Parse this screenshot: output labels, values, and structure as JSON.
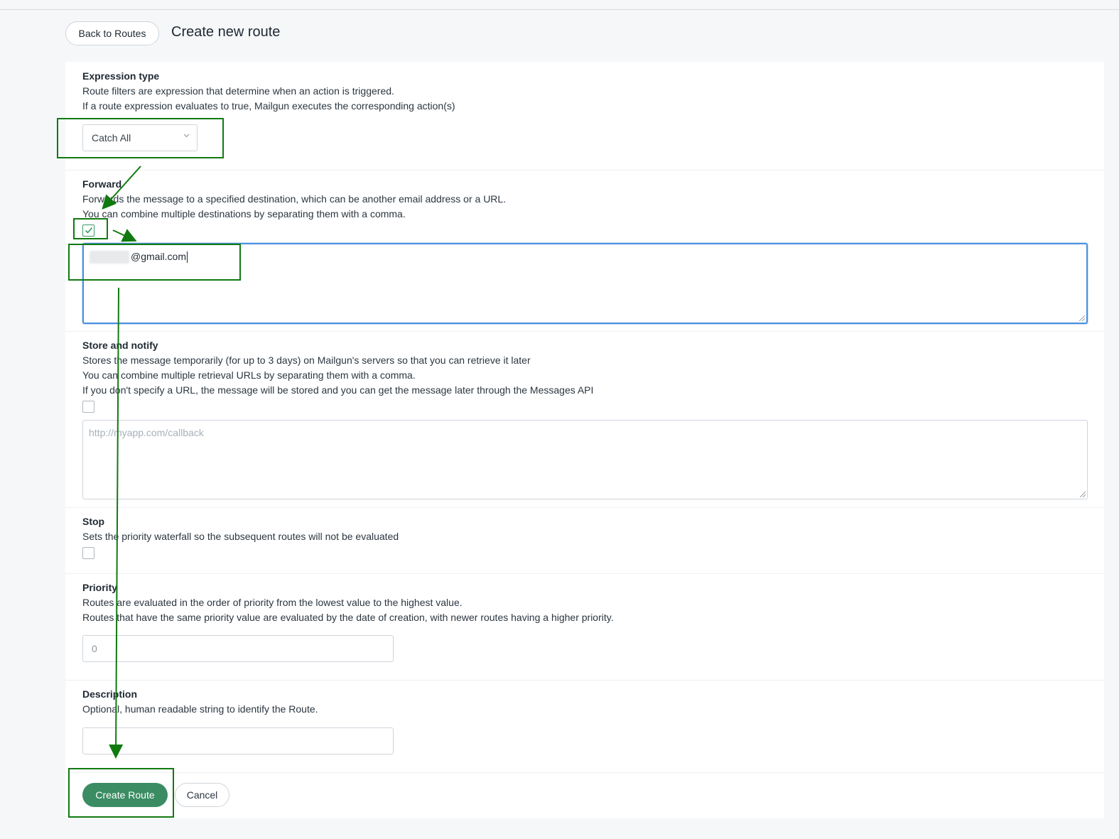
{
  "header": {
    "back_label": "Back to Routes",
    "title": "Create new route"
  },
  "expression": {
    "title": "Expression type",
    "desc1": "Route filters are expression that determine when an action is triggered.",
    "desc2": "If a route expression evaluates to true, Mailgun executes the corresponding action(s)",
    "selected": "Catch All",
    "chevron_icon": "chevron-down-icon"
  },
  "forward": {
    "title": "Forward",
    "desc1": "Forwards the message to a specified destination, which can be another email address or a URL.",
    "desc2": "You can combine multiple destinations by separating them with a comma.",
    "checked": true,
    "value": "@gmail.com"
  },
  "store": {
    "title": "Store and notify",
    "desc1": "Stores the message temporarily (for up to 3 days) on Mailgun's servers so that you can retrieve it later",
    "desc2": "You can combine multiple retrieval URLs by separating them with a comma.",
    "desc3": "If you don't specify a URL, the message will be stored and you can get the message later through the Messages API",
    "checked": false,
    "placeholder": "http://myapp.com/callback"
  },
  "stop": {
    "title": "Stop",
    "desc1": "Sets the priority waterfall so the subsequent routes will not be evaluated",
    "checked": false
  },
  "priority": {
    "title": "Priority",
    "desc1": "Routes are evaluated in the order of priority from the lowest value to the highest value.",
    "desc2": "Routes that have the same priority value are evaluated by the date of creation, with newer routes having a higher priority.",
    "placeholder": "0"
  },
  "description": {
    "title": "Description",
    "desc1": "Optional, human readable string to identify the Route.",
    "value": ""
  },
  "actions": {
    "create_label": "Create Route",
    "cancel_label": "Cancel"
  },
  "colors": {
    "accent": "#3b8c63",
    "focus": "#4a90e2",
    "annotation": "#107a10"
  }
}
